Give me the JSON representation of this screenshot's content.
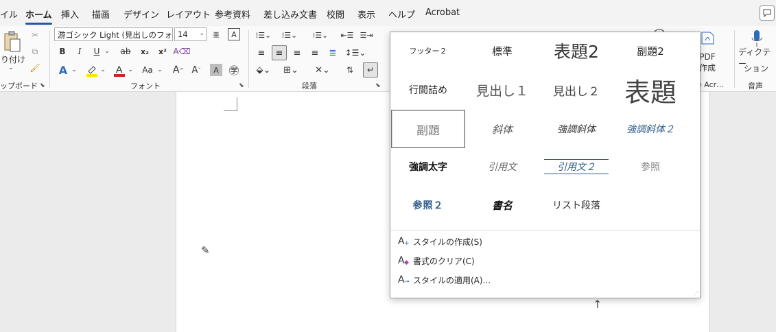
{
  "tabs": [
    {
      "label": "イル",
      "x": 0
    },
    {
      "label": "ホーム",
      "active": true
    },
    {
      "label": "挿入"
    },
    {
      "label": "描画"
    },
    {
      "label": "デザイン"
    },
    {
      "label": "レイアウト"
    },
    {
      "label": "参考資料"
    },
    {
      "label": "差し込み文書"
    },
    {
      "label": "校閲"
    },
    {
      "label": "表示"
    },
    {
      "label": "ヘルプ"
    },
    {
      "label": "Acrobat"
    }
  ],
  "ribbon": {
    "clipboard": {
      "paste_label": "り付け",
      "group_label": "ップボード"
    },
    "font": {
      "font_name": "游ゴシック Light (見出しのフォン",
      "font_size": "14",
      "group_label": "フォント",
      "bold": "B",
      "italic": "I",
      "underline": "U",
      "strike": "ab",
      "subscript": "x₂",
      "superscript": "x²",
      "case": "Aa"
    },
    "paragraph": {
      "group_label": "段落"
    },
    "pdf": {
      "label_line1": "PDF",
      "label_line2": "作成",
      "group_label": "e Acr…"
    },
    "voice": {
      "label_line1": "ディクテー",
      "label_line2": "ション",
      "group_label": "音声"
    }
  },
  "gallery": {
    "styles": [
      {
        "label": "フッター２",
        "cls": "s-footer"
      },
      {
        "label": "標準",
        "cls": "s-normal"
      },
      {
        "label": "表題2",
        "cls": "s-title2"
      },
      {
        "label": "副題2",
        "cls": "s-subtitle2"
      },
      {
        "label": "行間詰め",
        "cls": "s-linespace"
      },
      {
        "label": "見出し１",
        "cls": "s-h1"
      },
      {
        "label": "見出し２",
        "cls": "s-h2"
      },
      {
        "label": "表題",
        "cls": "s-title"
      },
      {
        "label": "副題",
        "cls": "s-subtitle",
        "selected": true
      },
      {
        "label": "斜体",
        "cls": "s-emph"
      },
      {
        "label": "強調斜体",
        "cls": "s-intemph"
      },
      {
        "label": "強調斜体２",
        "cls": "s-intemph2"
      },
      {
        "label": "強調太字",
        "cls": "s-strong"
      },
      {
        "label": "引用文",
        "cls": "s-quote"
      },
      {
        "label": "引用文２",
        "cls": "s-quote2"
      },
      {
        "label": "参照",
        "cls": "s-ref"
      },
      {
        "label": "参照２",
        "cls": "s-intref"
      },
      {
        "label": "書名",
        "cls": "s-book"
      },
      {
        "label": "リスト段落",
        "cls": "s-list"
      }
    ],
    "menu": [
      {
        "label": "スタイルの作成(S)",
        "icon": "create-style-icon"
      },
      {
        "label": "書式のクリア(C)",
        "icon": "clear-formatting-icon"
      },
      {
        "label": "スタイルの適用(A)...",
        "icon": "apply-styles-icon"
      }
    ]
  }
}
